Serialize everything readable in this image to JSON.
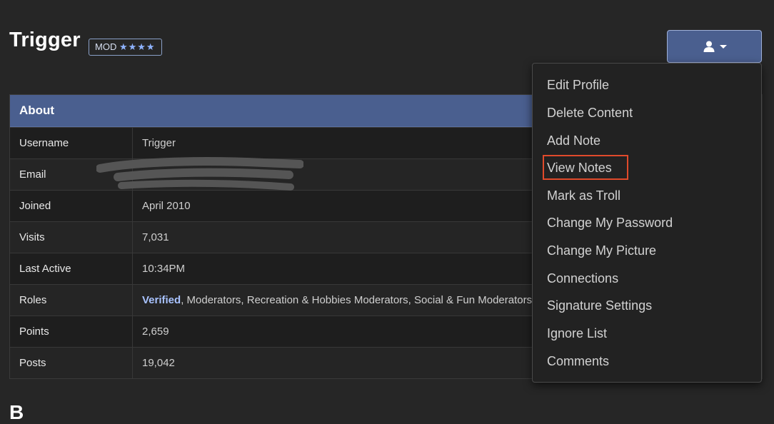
{
  "profile": {
    "name": "Trigger",
    "rank_label": "MOD",
    "rank_stars": "★★★★"
  },
  "about": {
    "title": "About",
    "rows": {
      "username": {
        "label": "Username",
        "value": "Trigger"
      },
      "email": {
        "label": "Email",
        "value": ""
      },
      "joined": {
        "label": "Joined",
        "value": "April 2010"
      },
      "visits": {
        "label": "Visits",
        "value": "7,031"
      },
      "last_active": {
        "label": "Last Active",
        "value": "10:34PM"
      },
      "roles": {
        "label": "Roles",
        "verified": "Verified",
        "rest": ", Moderators, Recreation & Hobbies Moderators, Social & Fun Moderators, S"
      },
      "points": {
        "label": "Points",
        "value": "2,659"
      },
      "posts": {
        "label": "Posts",
        "value": "19,042"
      }
    }
  },
  "options_menu": {
    "button_icon": "user-icon",
    "items": [
      "Edit Profile",
      "Delete Content",
      "Add Note",
      "View Notes",
      "Mark as Troll",
      "Change My Password",
      "Change My Picture",
      "Connections",
      "Signature Settings",
      "Ignore List",
      "Comments"
    ],
    "highlighted_item": "View Notes"
  },
  "colors": {
    "background": "#262626",
    "accent": "#4a5f8f",
    "highlight": "#e04a2b"
  }
}
